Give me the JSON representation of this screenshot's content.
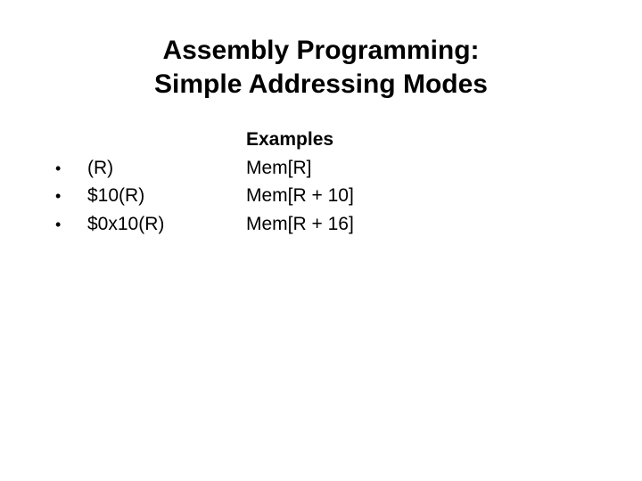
{
  "title": {
    "line1": "Assembly Programming:",
    "line2": "Simple Addressing Modes"
  },
  "examples_label": "Examples",
  "bullet_glyph": "•",
  "rows": [
    {
      "mode": "(R)",
      "meaning": "Mem[R]"
    },
    {
      "mode": "$10(R)",
      "meaning": "Mem[R + 10]"
    },
    {
      "mode": "$0x10(R)",
      "meaning": "Mem[R + 16]"
    }
  ]
}
